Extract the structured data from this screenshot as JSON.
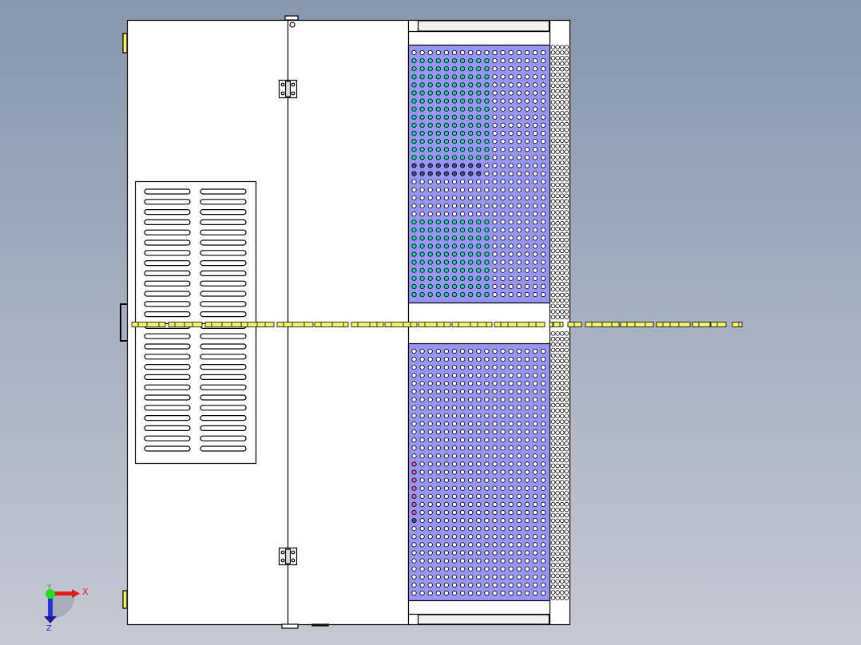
{
  "viewport": {
    "triad": {
      "x_label": "X",
      "y_label": "Y",
      "z_label": "Z"
    },
    "colors": {
      "panel_fill": "#9696f6",
      "dot_plain": "#ffffff",
      "dot_green": "#1fd79a",
      "dot_dark": "#4a4a8a",
      "dot_pink": "#e05aa0",
      "cable": "#f2f26a"
    }
  }
}
